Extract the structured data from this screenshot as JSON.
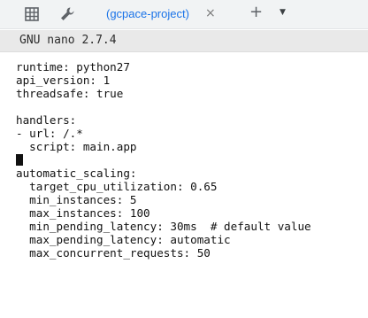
{
  "tabbar": {
    "tab_title": "(gcpace-project)",
    "tab_close": "×",
    "new_tab": "+",
    "menu": "▼",
    "icons": [
      "grid-icon",
      "wrench-icon"
    ]
  },
  "nano": {
    "title": "GNU nano 2.7.4"
  },
  "editor": {
    "lines": [
      "runtime: python27",
      "api_version: 1",
      "threadsafe: true",
      "",
      "handlers:",
      "- url: /.*",
      "  script: main.app",
      "",
      "automatic_scaling:",
      "  target_cpu_utilization: 0.65",
      "  min_instances: 5",
      "  max_instances: 100",
      "  min_pending_latency: 30ms  # default value",
      "  max_pending_latency: automatic",
      "  max_concurrent_requests: 50"
    ],
    "cursor_line": 7
  }
}
